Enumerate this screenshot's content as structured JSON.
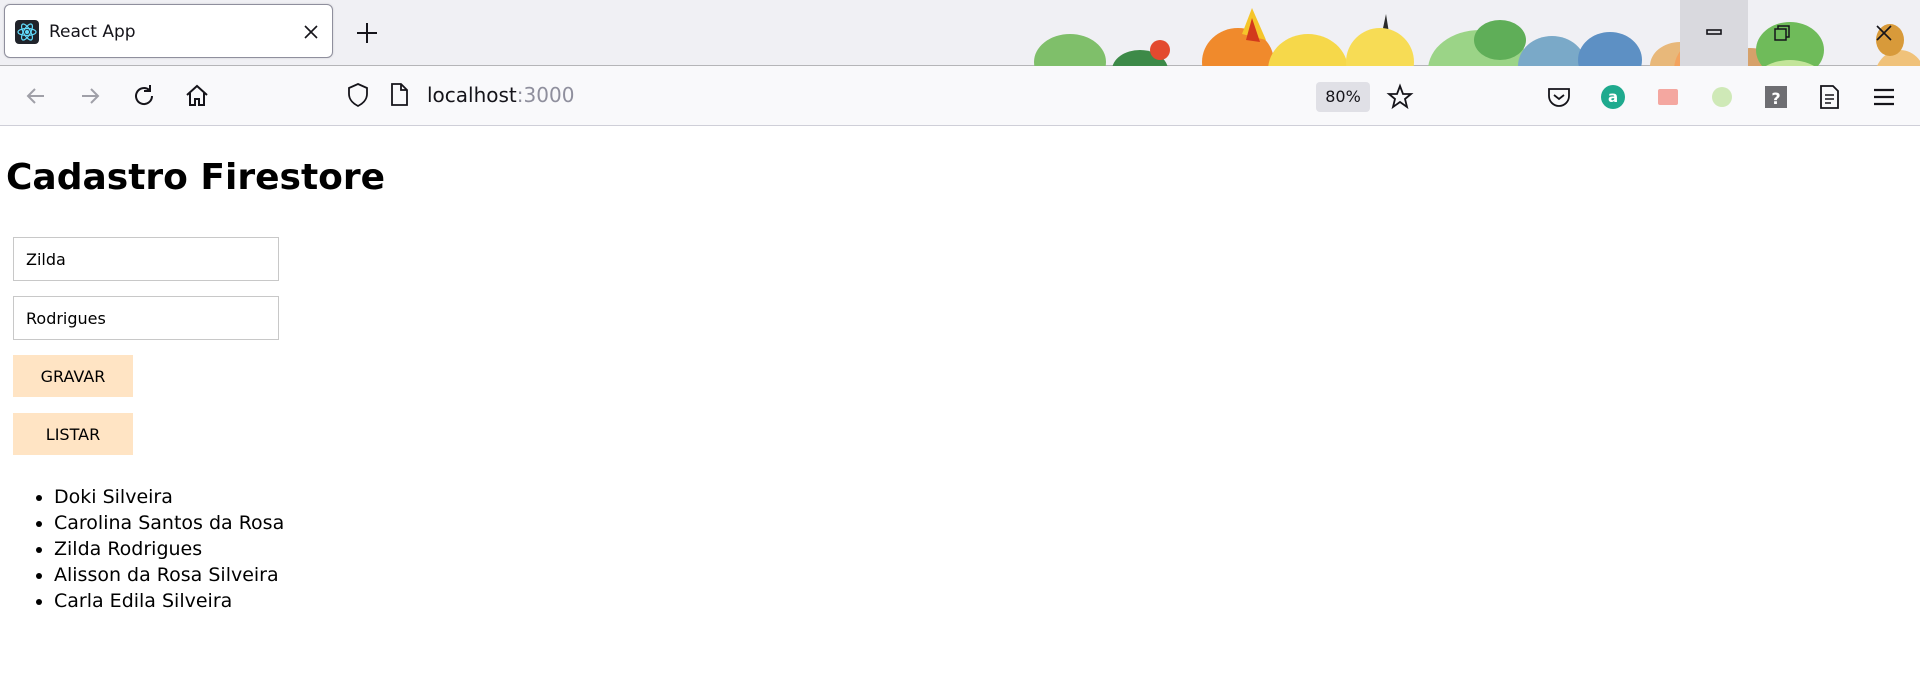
{
  "browser": {
    "tab": {
      "title": "React App",
      "favicon": "react-logo-icon"
    },
    "new_tab_icon": "plus-icon",
    "window_controls": [
      "minimize-icon",
      "restore-icon",
      "close-icon"
    ],
    "nav": {
      "back_icon": "arrow-left-icon",
      "forward_icon": "arrow-right-icon",
      "reload_icon": "reload-icon",
      "home_icon": "home-icon"
    },
    "url": {
      "host": "localhost",
      "port": ":3000"
    },
    "zoom": "80%",
    "toolbar_icons": [
      "star-icon",
      "pocket-icon",
      "extension-a-icon",
      "extension-icon",
      "extension-icon",
      "help-extension-icon",
      "reader-icon",
      "menu-icon"
    ]
  },
  "page": {
    "title": "Cadastro Firestore",
    "form": {
      "first_name": "Zilda",
      "last_name": "Rodrigues",
      "save_label": "GRAVAR",
      "list_label": "LISTAR"
    },
    "names": [
      "Doki Silveira",
      "Carolina Santos da Rosa",
      "Zilda Rodrigues",
      "Alisson da Rosa Silveira",
      "Carla Edila Silveira"
    ]
  },
  "colors": {
    "button_bg": "#ffe4c4",
    "tabstrip_bg": "#f0f0f4",
    "navbar_bg": "#f9f9fb"
  }
}
